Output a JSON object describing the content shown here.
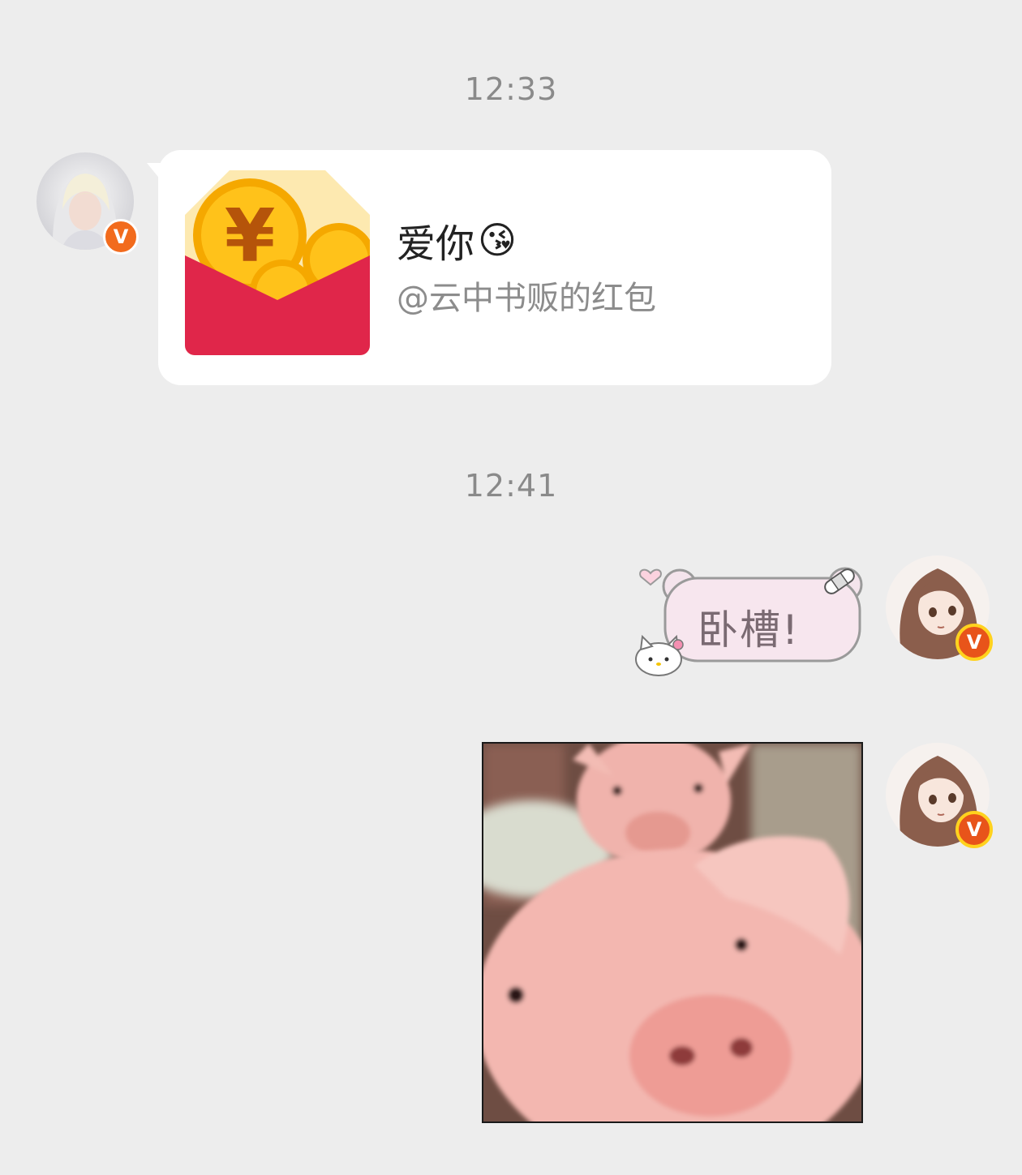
{
  "messages": {
    "time_1": "12:33",
    "time_2": "12:41",
    "red_packet": {
      "title": "爱你",
      "title_emoji": "😘",
      "subtitle": "@云中书贩的红包"
    },
    "sticker_text": "卧槽!",
    "image_description_icon": "pig-photo"
  },
  "badges": {
    "verified_label": "V"
  },
  "colors": {
    "background": "#ededed",
    "bubble": "#ffffff",
    "packet_red": "#e0264a",
    "packet_top": "#fde9b0",
    "coin": "#f7b500",
    "badge": "#f26b1d",
    "timestamp": "#8a8a8a"
  }
}
